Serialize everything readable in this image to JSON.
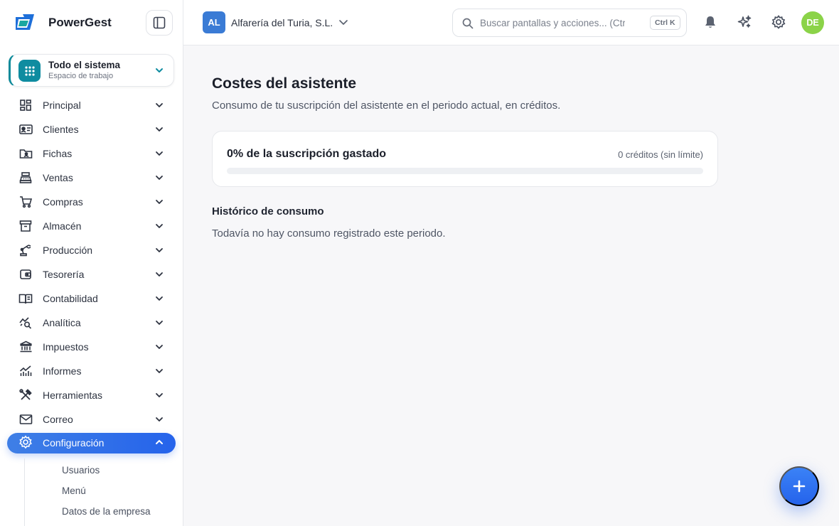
{
  "brand": {
    "name": "PowerGest",
    "logo_icon": "powergest-logo"
  },
  "workspace": {
    "title": "Todo el sistema",
    "subtitle": "Espacio de trabajo"
  },
  "nav": {
    "items": [
      {
        "label": "Principal",
        "icon": "dashboard-icon"
      },
      {
        "label": "Clientes",
        "icon": "id-card-icon"
      },
      {
        "label": "Fichas",
        "icon": "folder-user-icon"
      },
      {
        "label": "Ventas",
        "icon": "cash-register-icon"
      },
      {
        "label": "Compras",
        "icon": "cart-icon"
      },
      {
        "label": "Almacén",
        "icon": "archive-box-icon"
      },
      {
        "label": "Producción",
        "icon": "robot-arm-icon"
      },
      {
        "label": "Tesorería",
        "icon": "wallet-icon"
      },
      {
        "label": "Contabilidad",
        "icon": "open-book-icon"
      },
      {
        "label": "Analítica",
        "icon": "trend-search-icon"
      },
      {
        "label": "Impuestos",
        "icon": "bank-icon"
      },
      {
        "label": "Informes",
        "icon": "bar-chart-icon"
      },
      {
        "label": "Herramientas",
        "icon": "tools-icon"
      },
      {
        "label": "Correo",
        "icon": "mail-icon"
      },
      {
        "label": "Configuración",
        "icon": "gear-icon",
        "active": true
      }
    ],
    "subitems": [
      "Usuarios",
      "Menú",
      "Datos de la empresa"
    ]
  },
  "topbar": {
    "company_initials": "AL",
    "company_name": "Alfarería del Turia, S.L.",
    "search_placeholder": "Buscar pantallas y acciones... (Ctrl+K)",
    "search_shortcut": "Ctrl K",
    "avatar_initials": "DE"
  },
  "main": {
    "title": "Costes del asistente",
    "subtitle": "Consumo de tu suscripción del asistente en el periodo actual, en créditos.",
    "usage_card": {
      "label": "0% de la suscripción gastado",
      "credits": "0 créditos (sin límite)",
      "progress_percent": 0
    },
    "history_title": "Histórico de consumo",
    "history_empty": "Todavía no hay consumo registrado este periodo."
  },
  "colors": {
    "accent": "#2563eb",
    "workspace": "#0f8ca0",
    "avatar": "#8bd348"
  }
}
